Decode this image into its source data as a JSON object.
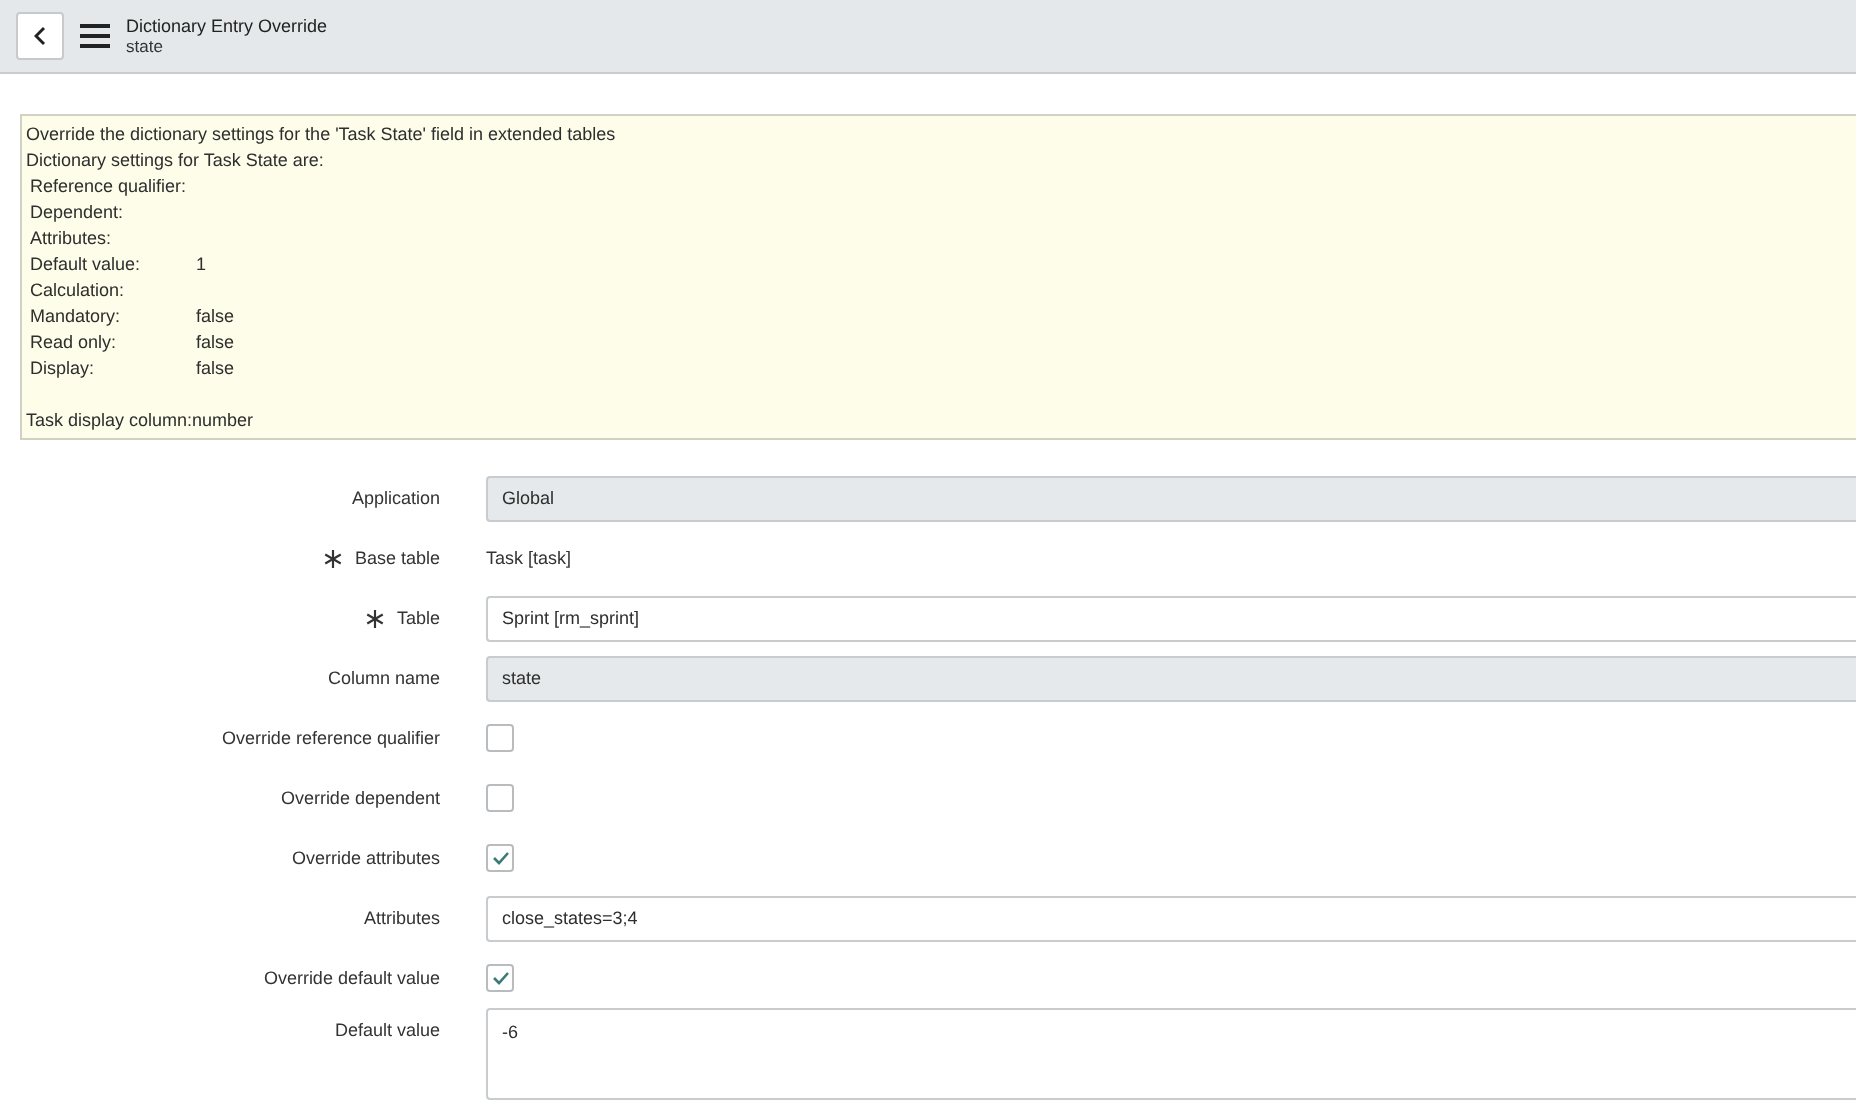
{
  "header": {
    "title": "Dictionary Entry Override",
    "subtitle": "state"
  },
  "info": {
    "heading": "Override the dictionary settings for the 'Task State' field in extended tables",
    "intro": "Dictionary settings for Task State are:",
    "settings": [
      {
        "label": "Reference qualifier:"
      },
      {
        "label": "Dependent:"
      },
      {
        "label": "Attributes:"
      },
      {
        "label": "Default value:",
        "value": "1"
      },
      {
        "label": "Calculation:"
      },
      {
        "label": "Mandatory:",
        "value": "false"
      },
      {
        "label": "Read only:",
        "value": "false"
      },
      {
        "label": "Display:",
        "value": "false"
      }
    ],
    "footer": "Task display column:number"
  },
  "form": [
    {
      "kind": "readonly",
      "label": "Application",
      "value": "Global",
      "mandatory": false
    },
    {
      "kind": "static",
      "label": "Base table",
      "value": "Task [task]",
      "mandatory": true
    },
    {
      "kind": "text",
      "label": "Table",
      "value": "Sprint [rm_sprint]",
      "mandatory": true
    },
    {
      "kind": "readonly",
      "label": "Column name",
      "value": "state",
      "mandatory": false
    },
    {
      "kind": "checkbox",
      "label": "Override reference qualifier",
      "checked": false,
      "mandatory": false
    },
    {
      "kind": "checkbox",
      "label": "Override dependent",
      "checked": false,
      "mandatory": false
    },
    {
      "kind": "checkbox",
      "label": "Override attributes",
      "checked": true,
      "mandatory": false
    },
    {
      "kind": "text",
      "label": "Attributes",
      "value": "close_states=3;4",
      "mandatory": false
    },
    {
      "kind": "checkbox",
      "label": "Override default value",
      "checked": true,
      "mandatory": false
    },
    {
      "kind": "textarea",
      "label": "Default value",
      "value": "-6",
      "mandatory": false
    }
  ]
}
